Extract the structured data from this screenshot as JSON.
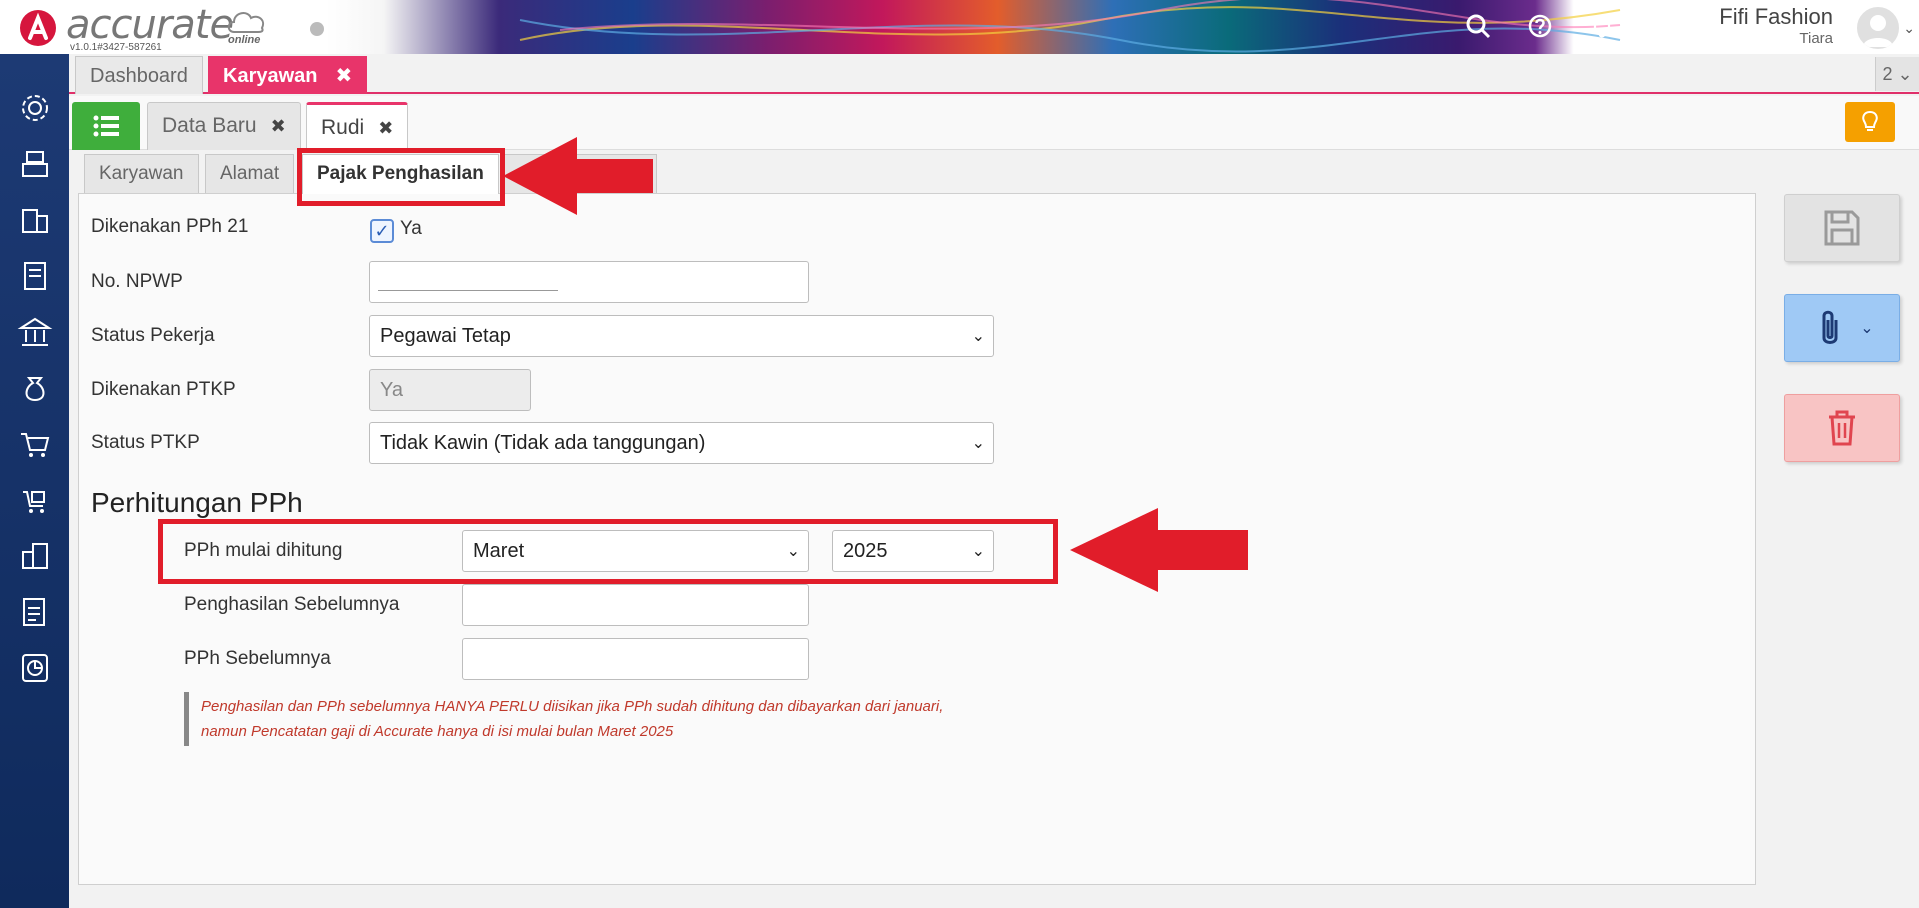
{
  "app": {
    "logo_text": "accurate",
    "logo_suffix": "online",
    "version": "v1.0.1#3427-587261",
    "company": "Fifi Fashion",
    "user": "Tiara"
  },
  "top_tabs": [
    {
      "label": "Dashboard",
      "active": false
    },
    {
      "label": "Karyawan",
      "active": true,
      "close": "✖"
    }
  ],
  "tab_counter": "2",
  "doc_tabs": [
    {
      "label": "Data Baru",
      "close": "✖"
    },
    {
      "label": "Rudi",
      "close": "✖"
    }
  ],
  "sub_tabs": [
    "Karyawan",
    "Alamat",
    "Pajak Penghasilan"
  ],
  "form": {
    "pph21_label": "Dikenakan PPh 21",
    "pph21_checked_label": "Ya",
    "npwp_label": "No. NPWP",
    "npwp_value": "",
    "status_pekerja_label": "Status Pekerja",
    "status_pekerja_value": "Pegawai Tetap",
    "ptkp_label": "Dikenakan PTKP",
    "ptkp_value": "Ya",
    "status_ptkp_label": "Status PTKP",
    "status_ptkp_value": "Tidak Kawin (Tidak ada tanggungan)"
  },
  "perhitungan": {
    "title": "Perhitungan PPh",
    "mulai_label": "PPh mulai dihitung",
    "mulai_month": "Maret",
    "mulai_year": "2025",
    "penghasilan_label": "Penghasilan Sebelumnya",
    "penghasilan_value": "",
    "pph_label": "PPh Sebelumnya",
    "pph_value": "",
    "note": "Penghasilan dan PPh sebelumnya HANYA PERLU diisikan jika PPh sudah dihitung dan dibayarkan dari januari, namun Pencatatan gaji di Accurate hanya di isi mulai bulan Maret 2025"
  },
  "colors": {
    "accent": "#e8346a",
    "annotation": "#e11d2a",
    "rail": "#1d3a74"
  }
}
